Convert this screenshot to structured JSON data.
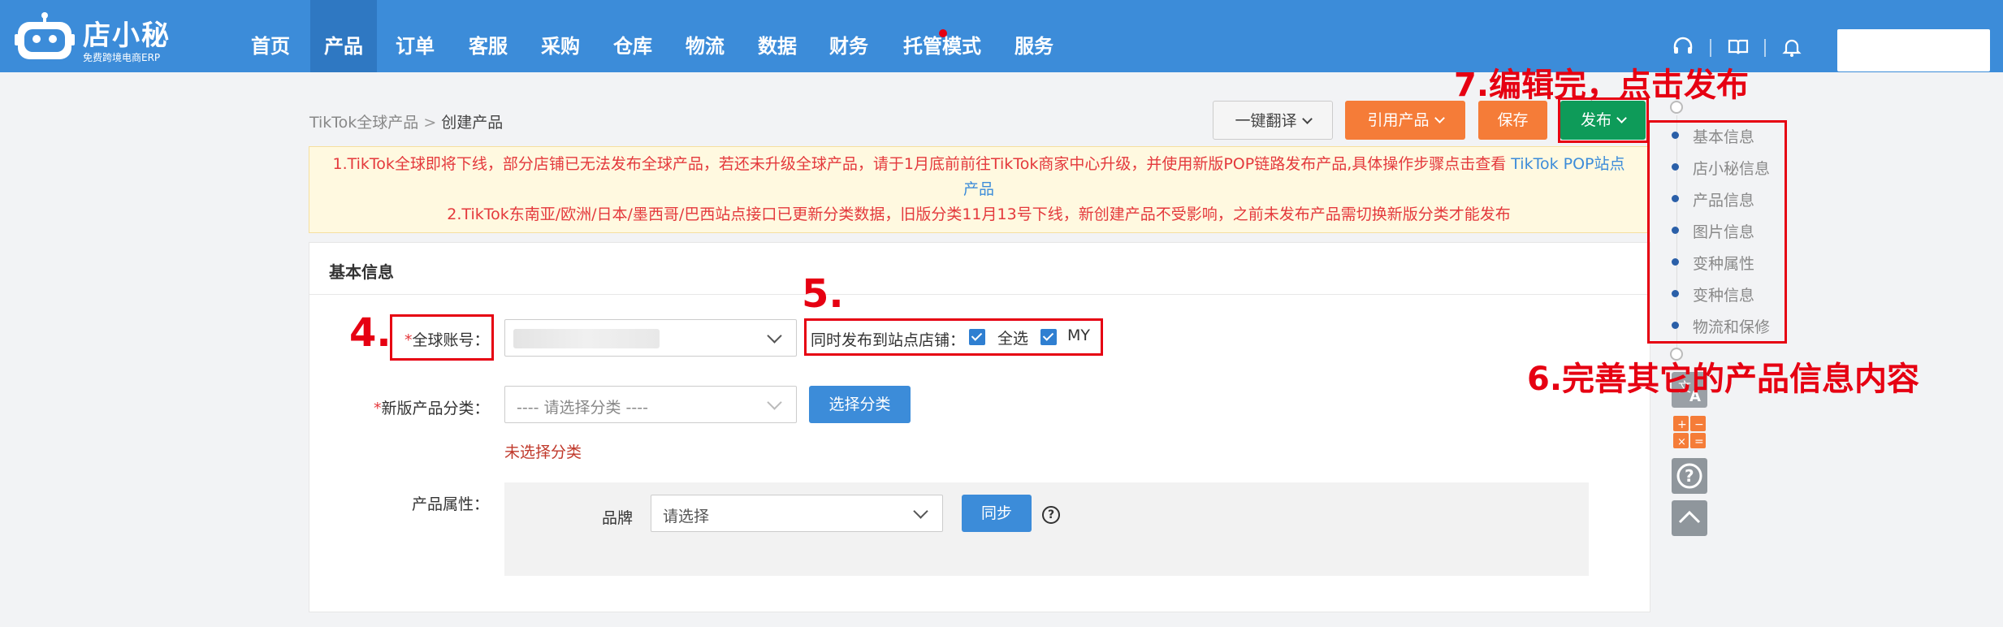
{
  "logo": {
    "title": "店小秘",
    "subtitle": "免费跨境电商ERP"
  },
  "nav": {
    "items": [
      {
        "label": "首页"
      },
      {
        "label": "产品"
      },
      {
        "label": "订单"
      },
      {
        "label": "客服"
      },
      {
        "label": "采购"
      },
      {
        "label": "仓库"
      },
      {
        "label": "物流"
      },
      {
        "label": "数据"
      },
      {
        "label": "财务"
      },
      {
        "label": "托管模式"
      },
      {
        "label": "服务"
      }
    ],
    "active": "产品",
    "icons": [
      "headset-icon",
      "book-icon",
      "bell-icon"
    ]
  },
  "breadcrumb": {
    "parent": "TikTok全球产品",
    "separator": ">",
    "current": "创建产品"
  },
  "toolbar": {
    "translate_label": "一键翻译",
    "cite_label": "引用产品",
    "save_label": "保存",
    "publish_label": "发布"
  },
  "notice": {
    "line1": "1.TikTok全球即将下线，部分店铺已无法发布全球产品，若还未升级全球产品，请于1月底前前往TikTok商家中心升级，并使用新版POP链路发布产品,具体操作步骤点击查看",
    "line1_link": "TikTok POP站点",
    "line1_link_cont": "产品",
    "line2": "2.TikTok东南亚/欧洲/日本/墨西哥/巴西站点接口已更新分类数据，旧版分类11月13号下线，新创建产品不受影响，之前未发布产品需切换新版分类才能发布"
  },
  "form": {
    "section_title": "基本信息",
    "global_account_label": "全球账号：",
    "sync_publish_label": "同时发布到站点店铺：",
    "select_all_label": "全选",
    "store_label": "MY",
    "category_label": "新版产品分类：",
    "category_placeholder": "---- 请选择分类 ----",
    "choose_category_label": "选择分类",
    "category_error": "未选择分类",
    "attributes_label": "产品属性：",
    "brand_label": "品牌",
    "brand_placeholder": "请选择",
    "sync_label": "同步",
    "help_symbol": "?"
  },
  "right_nav": {
    "items": [
      "基本信息",
      "店小秘信息",
      "产品信息",
      "图片信息",
      "变种属性",
      "变种信息",
      "物流和保修"
    ]
  },
  "annotations": {
    "step4": "4.",
    "step5": "5.",
    "step6": "6.完善其它的产品信息内容",
    "step7": "7.编辑完，点击发布"
  },
  "colors": {
    "nav_bg": "#3c8cd9",
    "orange": "#f57c38",
    "green": "#0e9b59",
    "annotation_red": "#e60012"
  }
}
